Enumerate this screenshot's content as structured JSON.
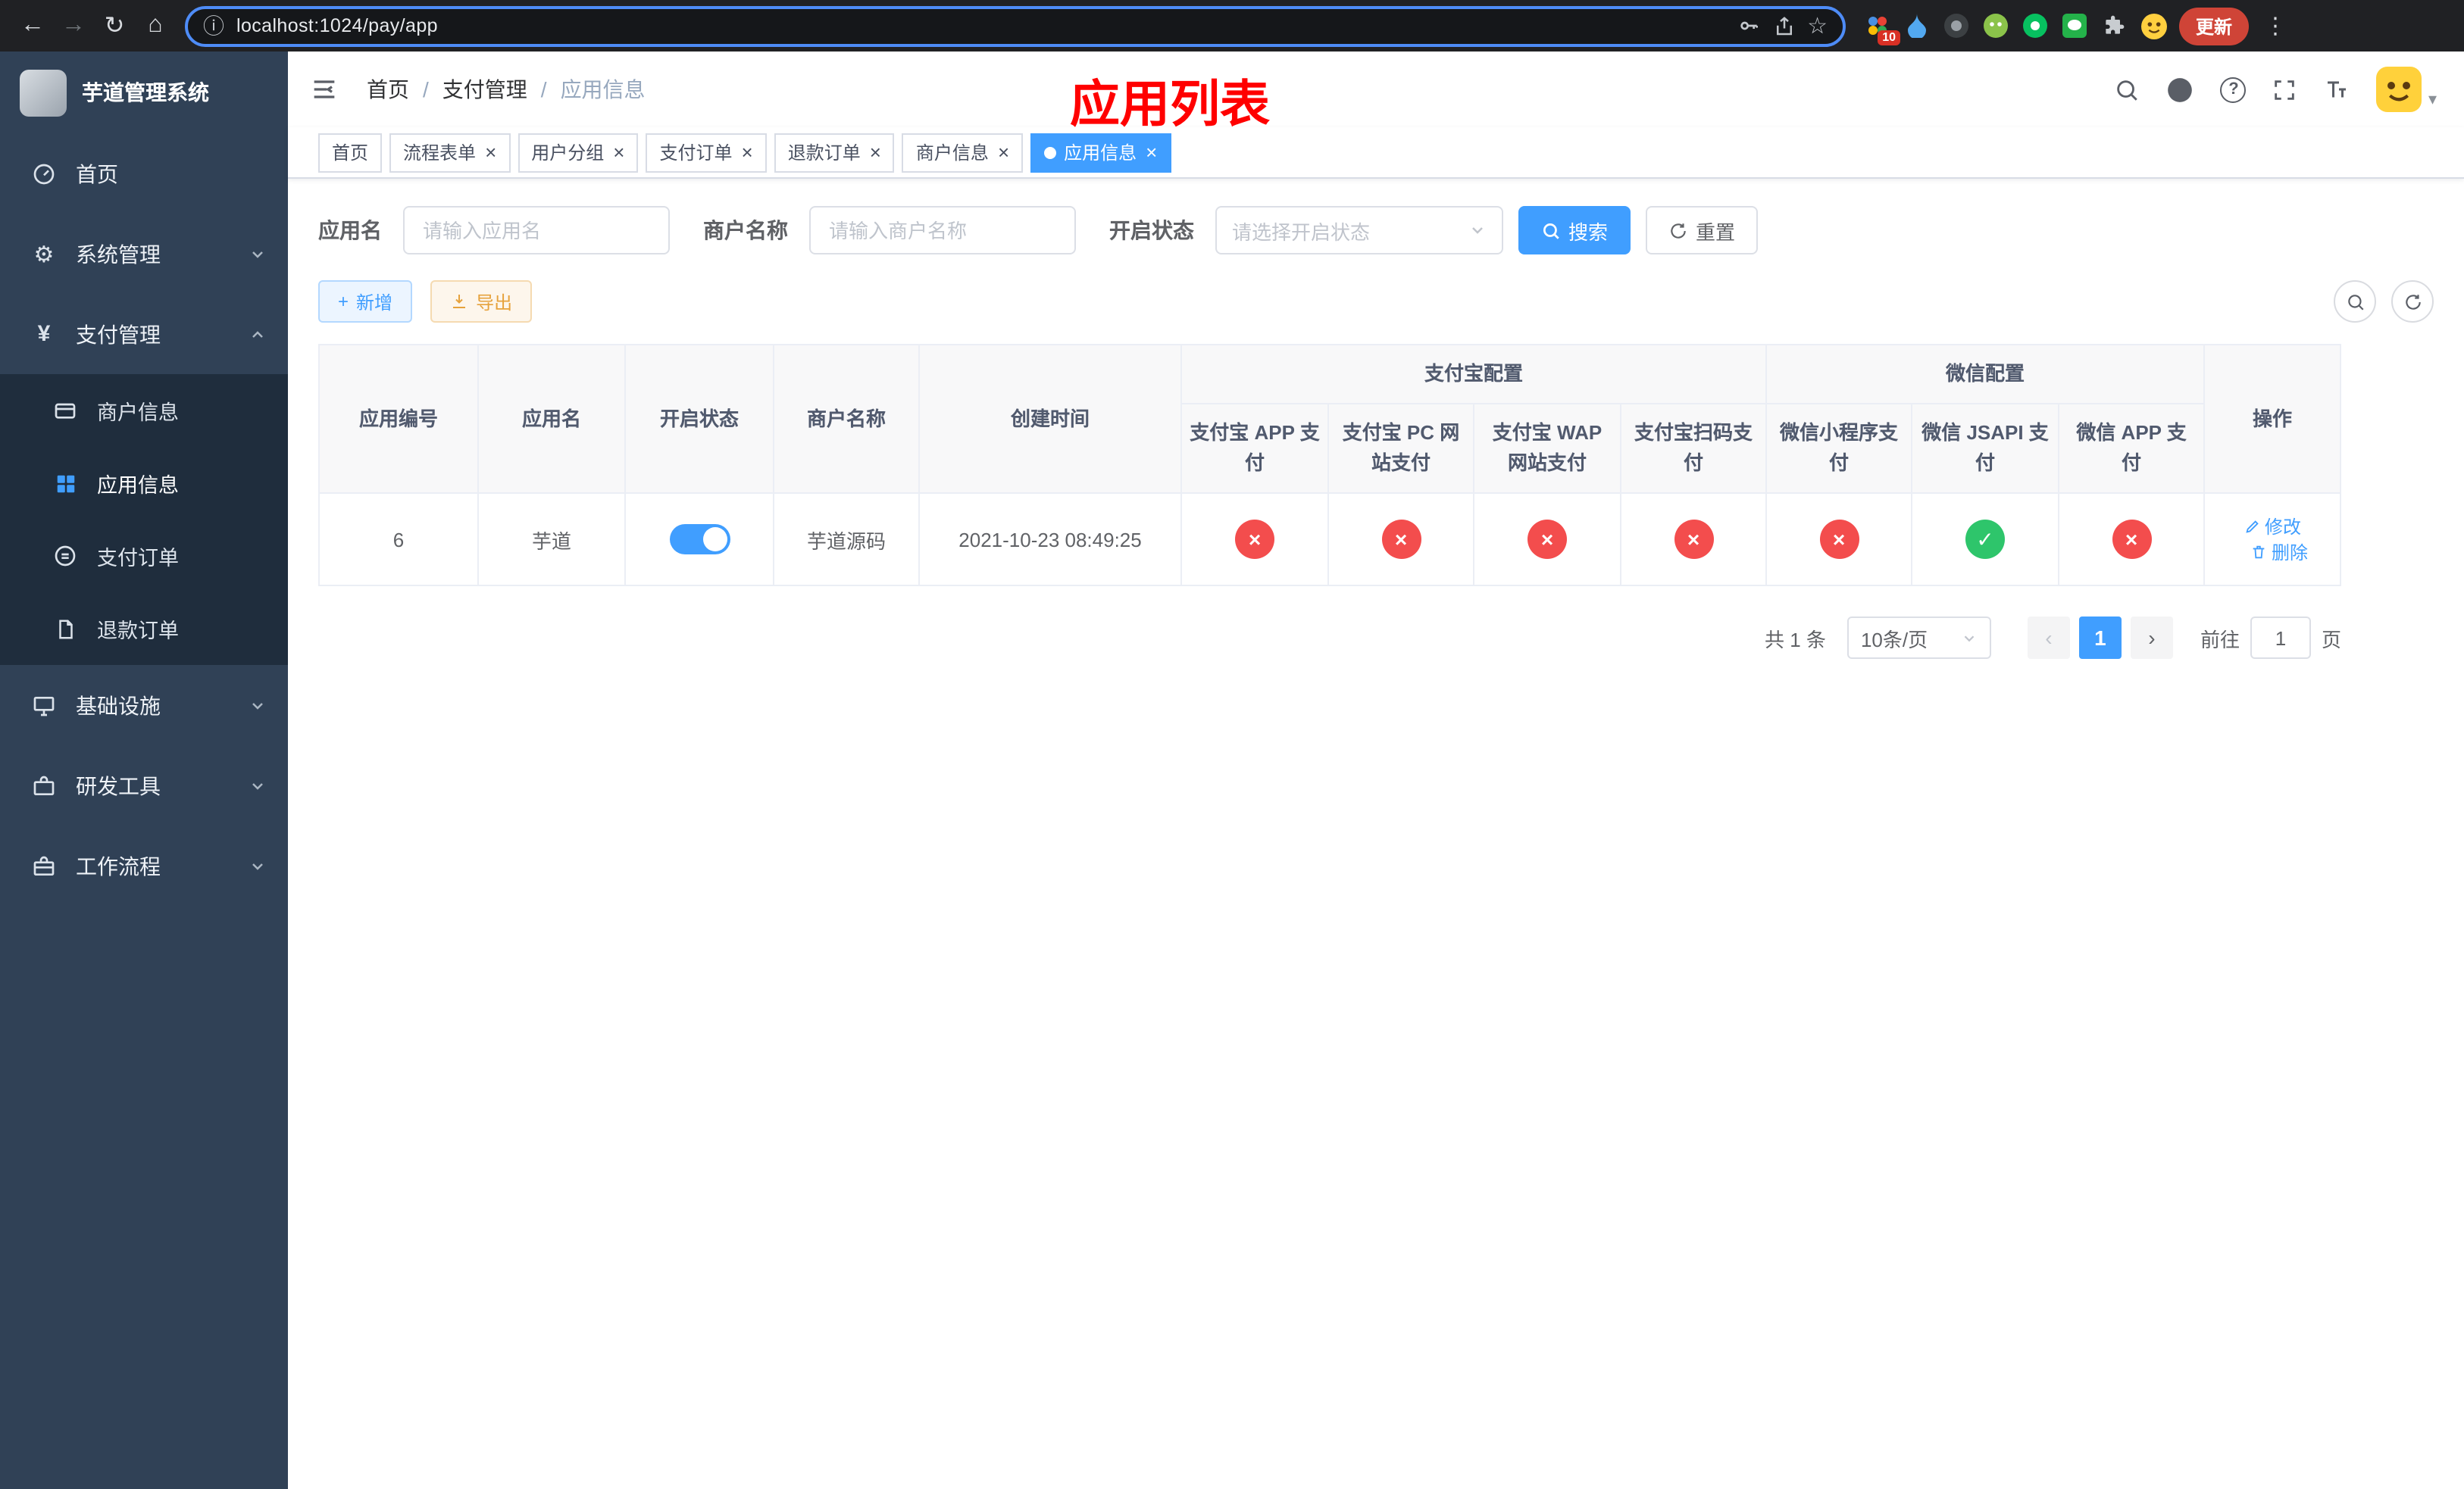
{
  "colors": {
    "accent": "#409EFF",
    "danger": "#F34D4D",
    "success": "#2EC56B"
  },
  "browser": {
    "url": "localhost:1024/pay/app",
    "update_label": "更新",
    "extension_badge": "10"
  },
  "annotation": {
    "title": "应用列表"
  },
  "sidebar": {
    "app_title": "芋道管理系统",
    "items": {
      "home": "首页",
      "system": "系统管理",
      "pay": "支付管理",
      "merchant": "商户信息",
      "app_info": "应用信息",
      "pay_order": "支付订单",
      "refund_order": "退款订单",
      "infra": "基础设施",
      "dev_tools": "研发工具",
      "workflow": "工作流程"
    }
  },
  "breadcrumb": {
    "home": "首页",
    "section": "支付管理",
    "current": "应用信息"
  },
  "tabs": [
    {
      "label": "首页"
    },
    {
      "label": "流程表单"
    },
    {
      "label": "用户分组"
    },
    {
      "label": "支付订单"
    },
    {
      "label": "退款订单"
    },
    {
      "label": "商户信息"
    },
    {
      "label": "应用信息"
    }
  ],
  "filters": {
    "app_name_label": "应用名",
    "app_name_placeholder": "请输入应用名",
    "merchant_label": "商户名称",
    "merchant_placeholder": "请输入商户名称",
    "status_label": "开启状态",
    "status_placeholder": "请选择开启状态",
    "search_label": "搜索",
    "reset_label": "重置"
  },
  "toolbar": {
    "add_label": "新增",
    "export_label": "导出"
  },
  "table": {
    "headers": {
      "app_id": "应用编号",
      "app_name": "应用名",
      "status": "开启状态",
      "merchant_name": "商户名称",
      "create_time": "创建时间",
      "alipay_group": "支付宝配置",
      "wechat_group": "微信配置",
      "alipay_app": "支付宝 APP 支付",
      "alipay_pc": "支付宝 PC 网站支付",
      "alipay_wap": "支付宝 WAP 网站支付",
      "alipay_qr": "支付宝扫码支付",
      "wx_mini": "微信小程序支付",
      "wx_jsapi": "微信 JSAPI 支付",
      "wx_app": "微信 APP 支付",
      "actions": "操作"
    },
    "row": {
      "app_id": "6",
      "app_name": "芋道",
      "status_on": true,
      "merchant_name": "芋道源码",
      "create_time": "2021-10-23 08:49:25",
      "alipay_app": false,
      "alipay_pc": false,
      "alipay_wap": false,
      "alipay_qr": false,
      "wx_mini": false,
      "wx_jsapi": true,
      "wx_app": false,
      "edit_label": "修改",
      "delete_label": "删除"
    }
  },
  "pagination": {
    "total_text": "共 1 条",
    "page_size_text": "10条/页",
    "current_page": "1",
    "goto_prefix": "前往",
    "goto_value": "1",
    "goto_suffix": "页"
  }
}
